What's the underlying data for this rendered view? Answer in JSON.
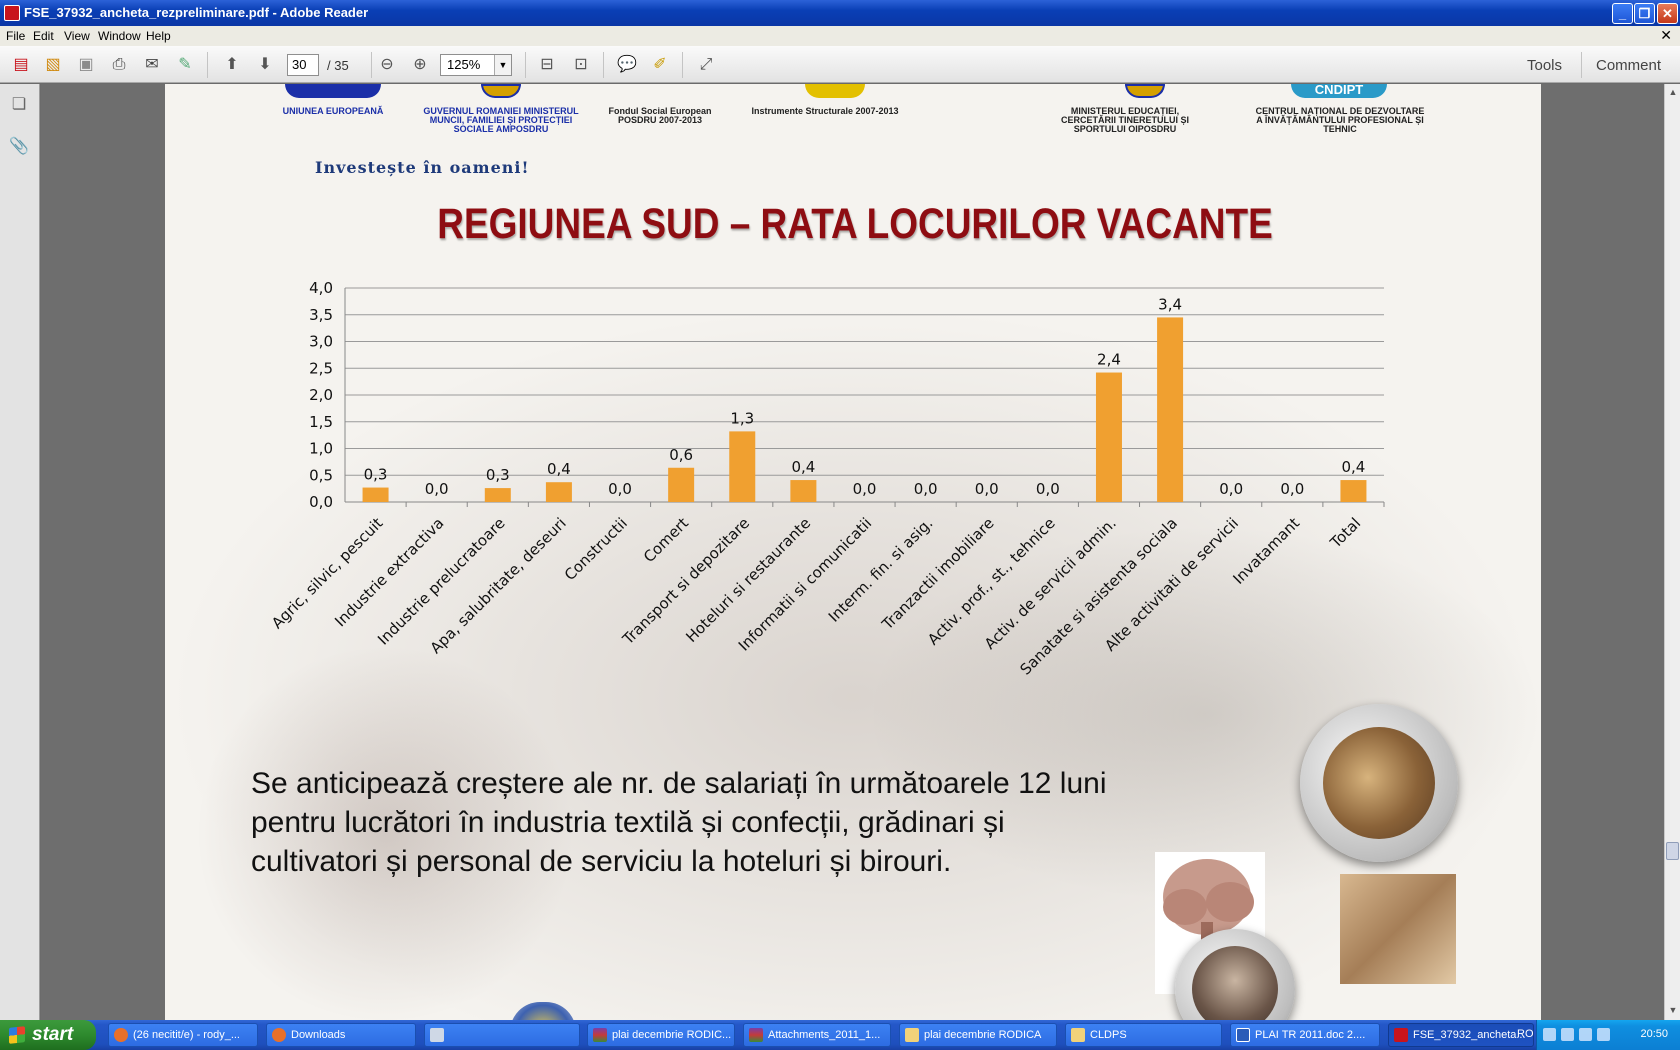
{
  "window": {
    "title": "FSE_37932_ancheta_rezpreliminare.pdf - Adobe Reader"
  },
  "menu": [
    "File",
    "Edit",
    "View",
    "Window",
    "Help"
  ],
  "toolbar": {
    "page_current": "30",
    "page_total": "/  35",
    "zoom": "125%",
    "tools_label": "Tools",
    "comment_label": "Comment"
  },
  "page": {
    "logos": {
      "eu": "UNIUNEA EUROPEANĂ",
      "gov": "GUVERNUL ROMANIEI MINISTERUL MUNCII, FAMILIEI ȘI PROTECȚIEI SOCIALE AMPOSDRU",
      "fse": "Fondul Social European POSDRU 2007-2013",
      "instr": "Instrumente Structurale 2007-2013",
      "min_edu": "MINISTERUL EDUCAȚIEI, CERCETĂRII TINERETULUI ȘI SPORTULUI OIPOSDRU",
      "cndipt_mark": "CNDIPT",
      "cndipt": "CENTRUL NAȚIONAL DE DEZVOLTARE A ÎNVĂȚĂMÂNTULUI PROFESIONAL ȘI TEHNIC"
    },
    "slogan": "Investește în oameni!",
    "title": "REGIUNEA SUD – RATA LOCURILOR VACANTE",
    "body_text": "Se anticipează creștere ale nr. de salariați în următoarele 12 luni pentru lucrători în industria textilă și confecții, grădinari și cultivatori și personal de serviciu la hoteluri și birouri."
  },
  "chart_data": {
    "type": "bar",
    "categories": [
      "Agric, silvic, pescuit",
      "Industrie extractiva",
      "Industrie prelucratoare",
      "Apa, salubritate, deseuri",
      "Constructii",
      "Comert",
      "Transport si depozitare",
      "Hoteluri si restaurante",
      "Informatii si comunicatii",
      "Interm. fin. si asig.",
      "Tranzactii imobiliare",
      "Activ. prof., st., tehnice",
      "Activ. de servicii admin.",
      "Sanatate si asistenta sociala",
      "Alte activitati de servicii",
      "Invatamant",
      "Total"
    ],
    "values": [
      0.27,
      0.0,
      0.26,
      0.37,
      0.0,
      0.64,
      1.32,
      0.41,
      0.0,
      0.0,
      0.0,
      0.0,
      2.42,
      3.45,
      0.0,
      0.0,
      0.41
    ],
    "labels": [
      "0,3",
      "0,0",
      "0,3",
      "0,4",
      "0,0",
      "0,6",
      "1,3",
      "0,4",
      "0,0",
      "0,0",
      "0,0",
      "0,0",
      "2,4",
      "3,4",
      "0,0",
      "0,0",
      "0,4"
    ],
    "yticks": [
      "0,0",
      "0,5",
      "1,0",
      "1,5",
      "2,0",
      "2,5",
      "3,0",
      "3,5",
      "4,0"
    ],
    "ylim": [
      0,
      4
    ],
    "grid": true,
    "bar_color": "#f0a030"
  },
  "taskbar": {
    "start": "start",
    "tasks": [
      "(26 necitit/e) - rody_...",
      "Downloads",
      "",
      "plai decembrie RODIC...",
      "Attachments_2011_1...",
      "plai decembrie RODICA",
      "CLDPS",
      "PLAI TR 2011.doc 2....",
      "FSE_37932_ancheta..."
    ],
    "lang": "RO",
    "clock": "20:50"
  }
}
